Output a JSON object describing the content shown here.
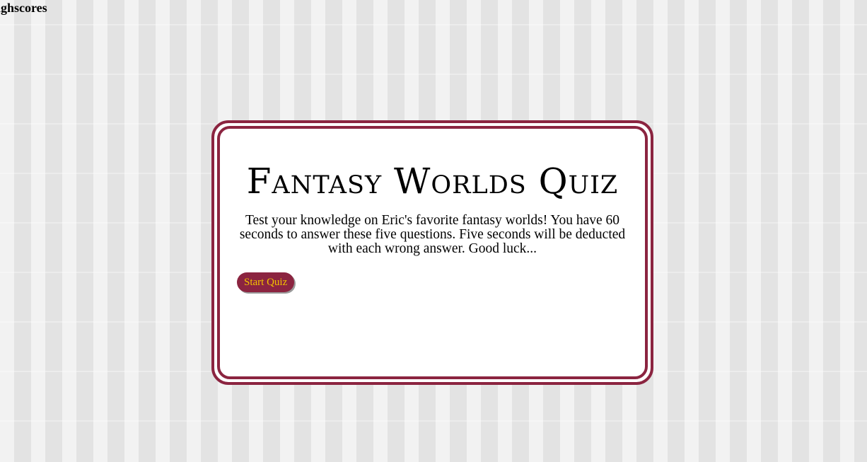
{
  "nav": {
    "highscores_label": "Highscores"
  },
  "quiz": {
    "title": "Fantasy Worlds Quiz",
    "intro": "Test your knowledge on Eric's favorite fantasy worlds! You have 60 seconds to answer these five questions. Five seconds will be deducted with each wrong answer. Good luck...",
    "start_button_label": "Start Quiz"
  },
  "colors": {
    "accent": "#8b2440",
    "button_text": "#f2c200",
    "card_background": "#ffffff"
  }
}
